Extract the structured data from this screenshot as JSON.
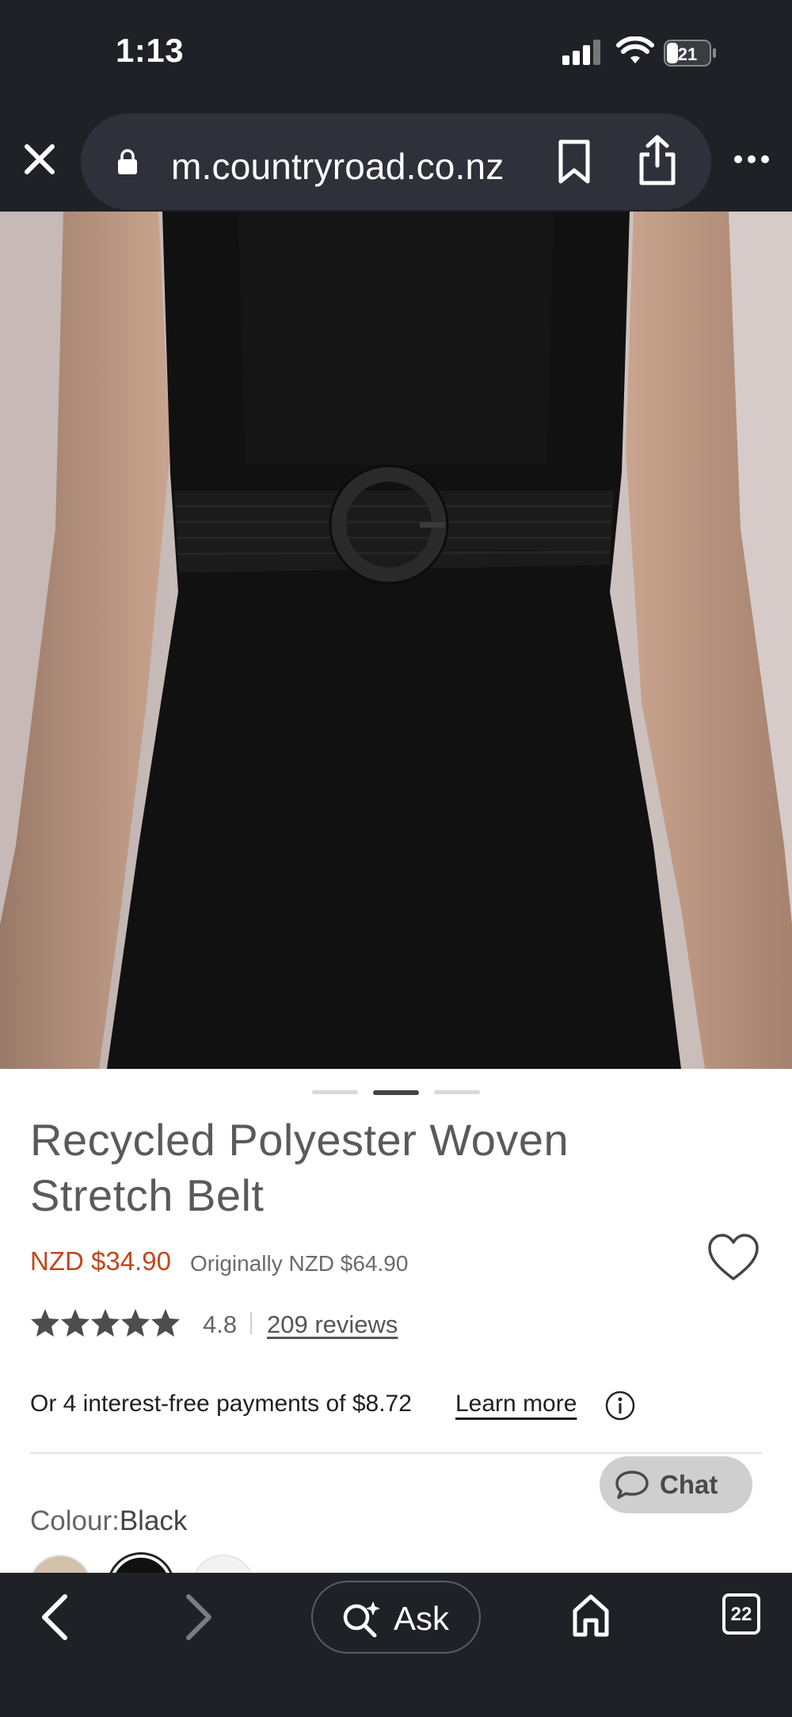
{
  "status_bar": {
    "time": "1:13",
    "battery": "21"
  },
  "browser": {
    "url": "m.countryroad.co.nz",
    "tab_count": "22",
    "ask_label": "Ask"
  },
  "product": {
    "title_line1": "Recycled Polyester Woven",
    "title_line2": "Stretch Belt",
    "price": "NZD $34.90",
    "original_price": "Originally NZD $64.90",
    "rating": "4.8",
    "reviews": "209 reviews",
    "stars": 5,
    "afterpay_text": "Or 4 interest-free payments of $8.72",
    "learn_more": "Learn more",
    "colour_label": "Colour:",
    "colour_value": "Black",
    "image_index": 2,
    "image_count": 3
  },
  "chat": {
    "label": "Chat"
  },
  "colors": {
    "chrome": "#1f2127",
    "pill": "#2e3139",
    "sale_price": "#c2461a",
    "text": "#5a5a5a"
  }
}
